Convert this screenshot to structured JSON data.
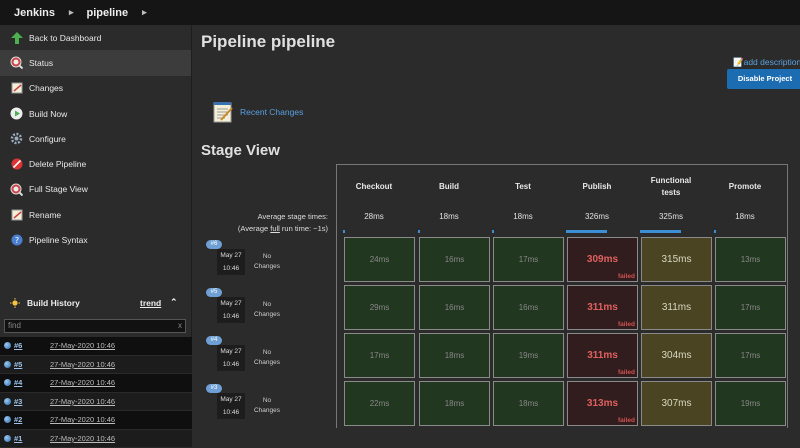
{
  "breadcrumb": {
    "root": "Jenkins",
    "job": "pipeline",
    "sep1": "▸",
    "sep2": "▸"
  },
  "sidebar": {
    "items": [
      {
        "label": "Back to Dashboard",
        "icon": "up-arrow-icon"
      },
      {
        "label": "Status",
        "icon": "search-icon"
      },
      {
        "label": "Changes",
        "icon": "notepad-icon"
      },
      {
        "label": "Build Now",
        "icon": "clock-play-icon"
      },
      {
        "label": "Configure",
        "icon": "gear-icon"
      },
      {
        "label": "Delete Pipeline",
        "icon": "no-entry-icon"
      },
      {
        "label": "Full Stage View",
        "icon": "search-icon"
      },
      {
        "label": "Rename",
        "icon": "notepad-icon"
      },
      {
        "label": "Pipeline Syntax",
        "icon": "help-icon"
      }
    ]
  },
  "build_history": {
    "title": "Build History",
    "trend": "trend",
    "search_placeholder": "find",
    "builds": [
      {
        "num": "#6",
        "date": "27-May-2020 10:46"
      },
      {
        "num": "#5",
        "date": "27-May-2020 10:46"
      },
      {
        "num": "#4",
        "date": "27-May-2020 10:46"
      },
      {
        "num": "#3",
        "date": "27-May-2020 10:46"
      },
      {
        "num": "#2",
        "date": "27-May-2020 10:46"
      },
      {
        "num": "#1",
        "date": "27-May-2020 10:46"
      }
    ]
  },
  "main": {
    "title": "Pipeline pipeline",
    "add_description": "add description",
    "disable_button": "Disable Project",
    "recent_changes": "Recent Changes",
    "stage_view_title": "Stage View",
    "avg_label_1": "Average stage times:",
    "avg_label_2a": "(Average ",
    "avg_label_2b": "full",
    "avg_label_2c": " run time: ~1s)"
  },
  "stages": [
    {
      "name": "Checkout",
      "avg": "28ms",
      "avg_fraction": 0.03
    },
    {
      "name": "Build",
      "avg": "18ms",
      "avg_fraction": 0.03
    },
    {
      "name": "Test",
      "avg": "18ms",
      "avg_fraction": 0.03
    },
    {
      "name": "Publish",
      "avg": "326ms",
      "avg_fraction": 0.85
    },
    {
      "name": "Functional tests",
      "avg": "325ms",
      "avg_fraction": 0.85
    },
    {
      "name": "Promote",
      "avg": "18ms",
      "avg_fraction": 0.03
    }
  ],
  "runs": [
    {
      "badge": "#6",
      "date": "May 27",
      "time": "10:46",
      "changes": "No Changes",
      "cells": [
        {
          "value": "24ms",
          "status": "ok"
        },
        {
          "value": "16ms",
          "status": "ok"
        },
        {
          "value": "17ms",
          "status": "ok"
        },
        {
          "value": "309ms",
          "status": "fail",
          "note": "failed"
        },
        {
          "value": "315ms",
          "status": "unstable"
        },
        {
          "value": "13ms",
          "status": "ok"
        }
      ]
    },
    {
      "badge": "#5",
      "date": "May 27",
      "time": "10:46",
      "changes": "No Changes",
      "cells": [
        {
          "value": "29ms",
          "status": "ok"
        },
        {
          "value": "16ms",
          "status": "ok"
        },
        {
          "value": "16ms",
          "status": "ok"
        },
        {
          "value": "311ms",
          "status": "fail",
          "note": "failed"
        },
        {
          "value": "311ms",
          "status": "unstable"
        },
        {
          "value": "17ms",
          "status": "ok"
        }
      ]
    },
    {
      "badge": "#4",
      "date": "May 27",
      "time": "10:46",
      "changes": "No Changes",
      "cells": [
        {
          "value": "17ms",
          "status": "ok"
        },
        {
          "value": "18ms",
          "status": "ok"
        },
        {
          "value": "19ms",
          "status": "ok"
        },
        {
          "value": "311ms",
          "status": "fail",
          "note": "failed"
        },
        {
          "value": "304ms",
          "status": "unstable"
        },
        {
          "value": "17ms",
          "status": "ok"
        }
      ]
    },
    {
      "badge": "#3",
      "date": "May 27",
      "time": "10:46",
      "changes": "No Changes",
      "cells": [
        {
          "value": "22ms",
          "status": "ok"
        },
        {
          "value": "18ms",
          "status": "ok"
        },
        {
          "value": "18ms",
          "status": "ok"
        },
        {
          "value": "313ms",
          "status": "fail",
          "note": "failed"
        },
        {
          "value": "307ms",
          "status": "unstable"
        },
        {
          "value": "19ms",
          "status": "ok"
        }
      ]
    }
  ]
}
